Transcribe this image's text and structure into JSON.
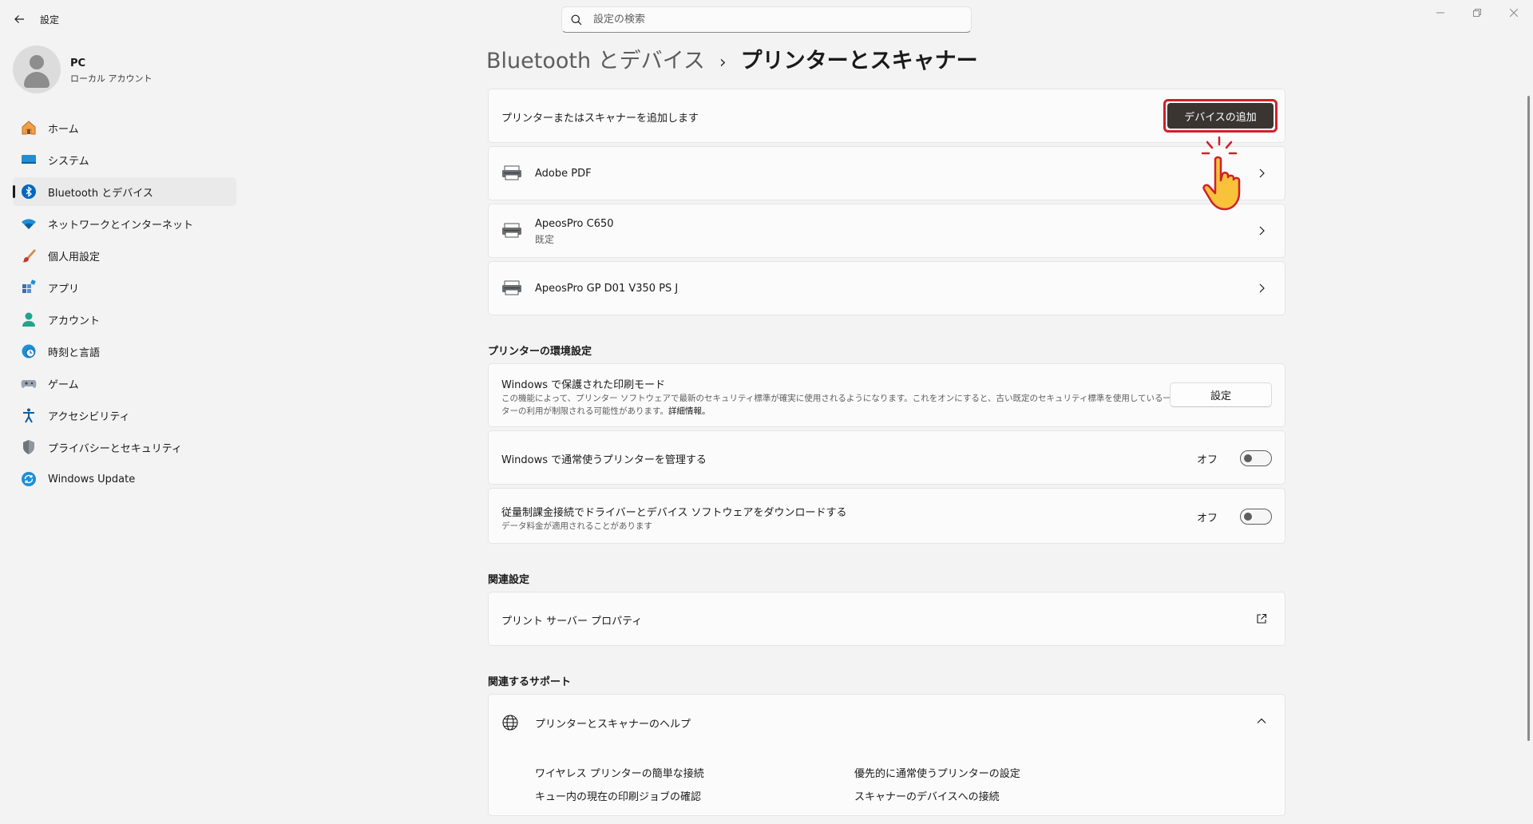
{
  "app": {
    "title": "設定"
  },
  "search": {
    "placeholder": "設定の検索"
  },
  "profile": {
    "name": "PC",
    "account_type": "ローカル アカウント"
  },
  "nav": {
    "items": [
      {
        "label": "ホーム",
        "icon": "home-icon"
      },
      {
        "label": "システム",
        "icon": "system-icon"
      },
      {
        "label": "Bluetooth とデバイス",
        "icon": "bluetooth-icon",
        "active": true
      },
      {
        "label": "ネットワークとインターネット",
        "icon": "wifi-icon"
      },
      {
        "label": "個人用設定",
        "icon": "brush-icon"
      },
      {
        "label": "アプリ",
        "icon": "apps-icon"
      },
      {
        "label": "アカウント",
        "icon": "account-icon"
      },
      {
        "label": "時刻と言語",
        "icon": "globe-clock-icon"
      },
      {
        "label": "ゲーム",
        "icon": "gamepad-icon"
      },
      {
        "label": "アクセシビリティ",
        "icon": "accessibility-icon"
      },
      {
        "label": "プライバシーとセキュリティ",
        "icon": "shield-icon"
      },
      {
        "label": "Windows Update",
        "icon": "update-icon"
      }
    ]
  },
  "breadcrumb": {
    "parent": "Bluetooth とデバイス",
    "separator": "›",
    "current": "プリンターとスキャナー"
  },
  "add_device": {
    "label": "プリンターまたはスキャナーを追加します",
    "button": "デバイスの追加"
  },
  "printers": [
    {
      "name": "Adobe PDF",
      "status": ""
    },
    {
      "name": "ApeosPro C650",
      "status": "既定"
    },
    {
      "name": "ApeosPro GP D01 V350 PS J",
      "status": ""
    }
  ],
  "preferences": {
    "heading": "プリンターの環境設定",
    "protected_mode": {
      "title": "Windows で保護された印刷モード",
      "desc_line1": "この機能によって、プリンター ソフトウェアで最新のセキュリティ標準が確実に使用されるようになります。これをオンにすると、古い既定のセキュリティ標準を使用している一部のプリン",
      "desc_line2": "ターの利用が制限される可能性があります。",
      "desc_link": "詳細情報。",
      "button": "設定"
    },
    "manage_default": {
      "title": "Windows で通常使うプリンターを管理する",
      "state": "オフ",
      "on": false
    },
    "metered_download": {
      "title": "従量制課金接続でドライバーとデバイス ソフトウェアをダウンロードする",
      "subtitle": "データ料金が適用されることがあります",
      "state": "オフ",
      "on": false
    }
  },
  "related_settings": {
    "heading": "関連設定",
    "print_server": "プリント サーバー プロパティ"
  },
  "related_support": {
    "heading": "関連するサポート",
    "help_title": "プリンターとスキャナーのヘルプ",
    "links": [
      "ワイヤレス プリンターの簡単な接続",
      "優先的に通常使うプリンターの設定",
      "キュー内の現在の印刷ジョブの確認",
      "スキャナーのデバイスへの接続"
    ]
  },
  "colors": {
    "accent": "#0067c0",
    "highlight": "#d0202a",
    "button_dark": "#3b3531"
  }
}
